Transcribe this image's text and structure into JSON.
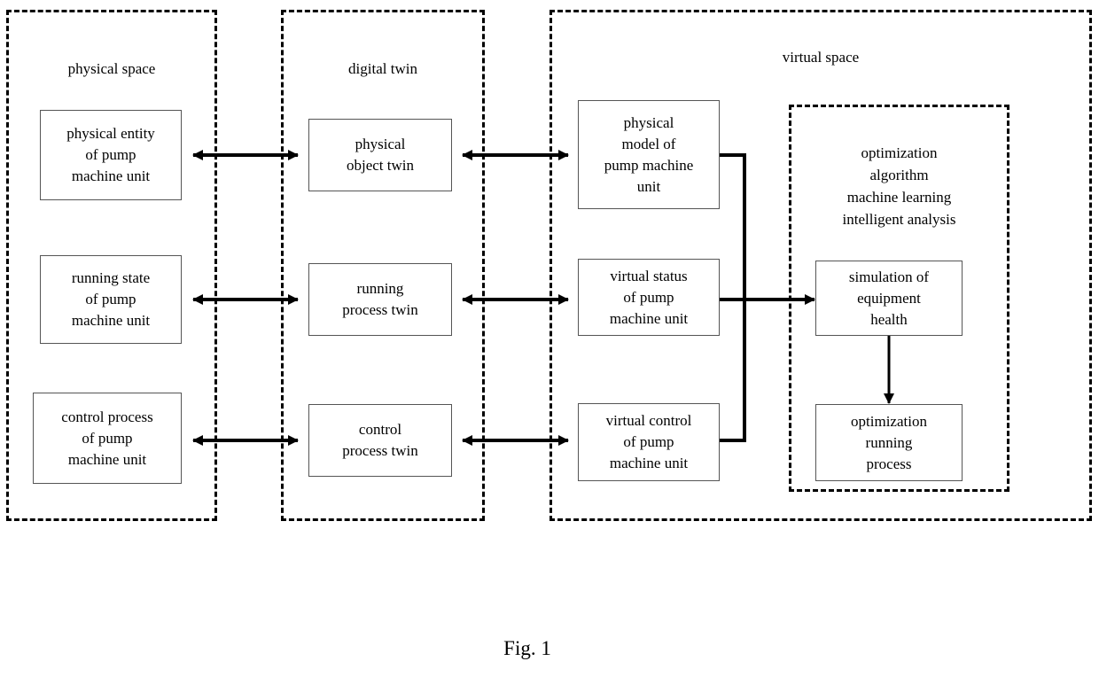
{
  "figure": {
    "caption": "Fig. 1"
  },
  "zones": [
    {
      "id": "physical-space",
      "title": "physical space"
    },
    {
      "id": "digital-twin",
      "title": "digital twin"
    },
    {
      "id": "virtual-space",
      "title": "virtual space"
    }
  ],
  "inner_zone": {
    "id": "analysis-group",
    "lines": [
      "optimization",
      "algorithm",
      "machine learning",
      "intelligent analysis"
    ]
  },
  "physical_space_nodes": [
    {
      "id": "physical-entity",
      "lines": [
        "physical entity",
        "of pump",
        "machine unit"
      ]
    },
    {
      "id": "running-state",
      "lines": [
        "running state",
        "of pump",
        "machine unit"
      ]
    },
    {
      "id": "control-process",
      "lines": [
        "control process",
        "of pump",
        "machine unit"
      ]
    }
  ],
  "digital_twin_nodes": [
    {
      "id": "physical-object-twin",
      "lines": [
        "physical",
        "object twin"
      ]
    },
    {
      "id": "running-process-twin",
      "lines": [
        "running",
        "process twin"
      ]
    },
    {
      "id": "control-process-twin",
      "lines": [
        "control",
        "process twin"
      ]
    }
  ],
  "virtual_space_nodes": [
    {
      "id": "physical-model",
      "lines": [
        "physical",
        "model of",
        "pump machine",
        "unit"
      ]
    },
    {
      "id": "virtual-status",
      "lines": [
        "virtual status",
        "of pump",
        "machine unit"
      ]
    },
    {
      "id": "virtual-control",
      "lines": [
        "virtual control",
        "of pump",
        "machine unit"
      ]
    }
  ],
  "analysis_nodes": [
    {
      "id": "simulation-equipment-health",
      "lines": [
        "simulation of",
        "equipment",
        "health"
      ]
    },
    {
      "id": "optimization-running-process",
      "lines": [
        "optimization",
        "running",
        "process"
      ]
    }
  ],
  "colors": {
    "stroke": "#000000",
    "box_border": "#555555",
    "background": "#ffffff"
  }
}
